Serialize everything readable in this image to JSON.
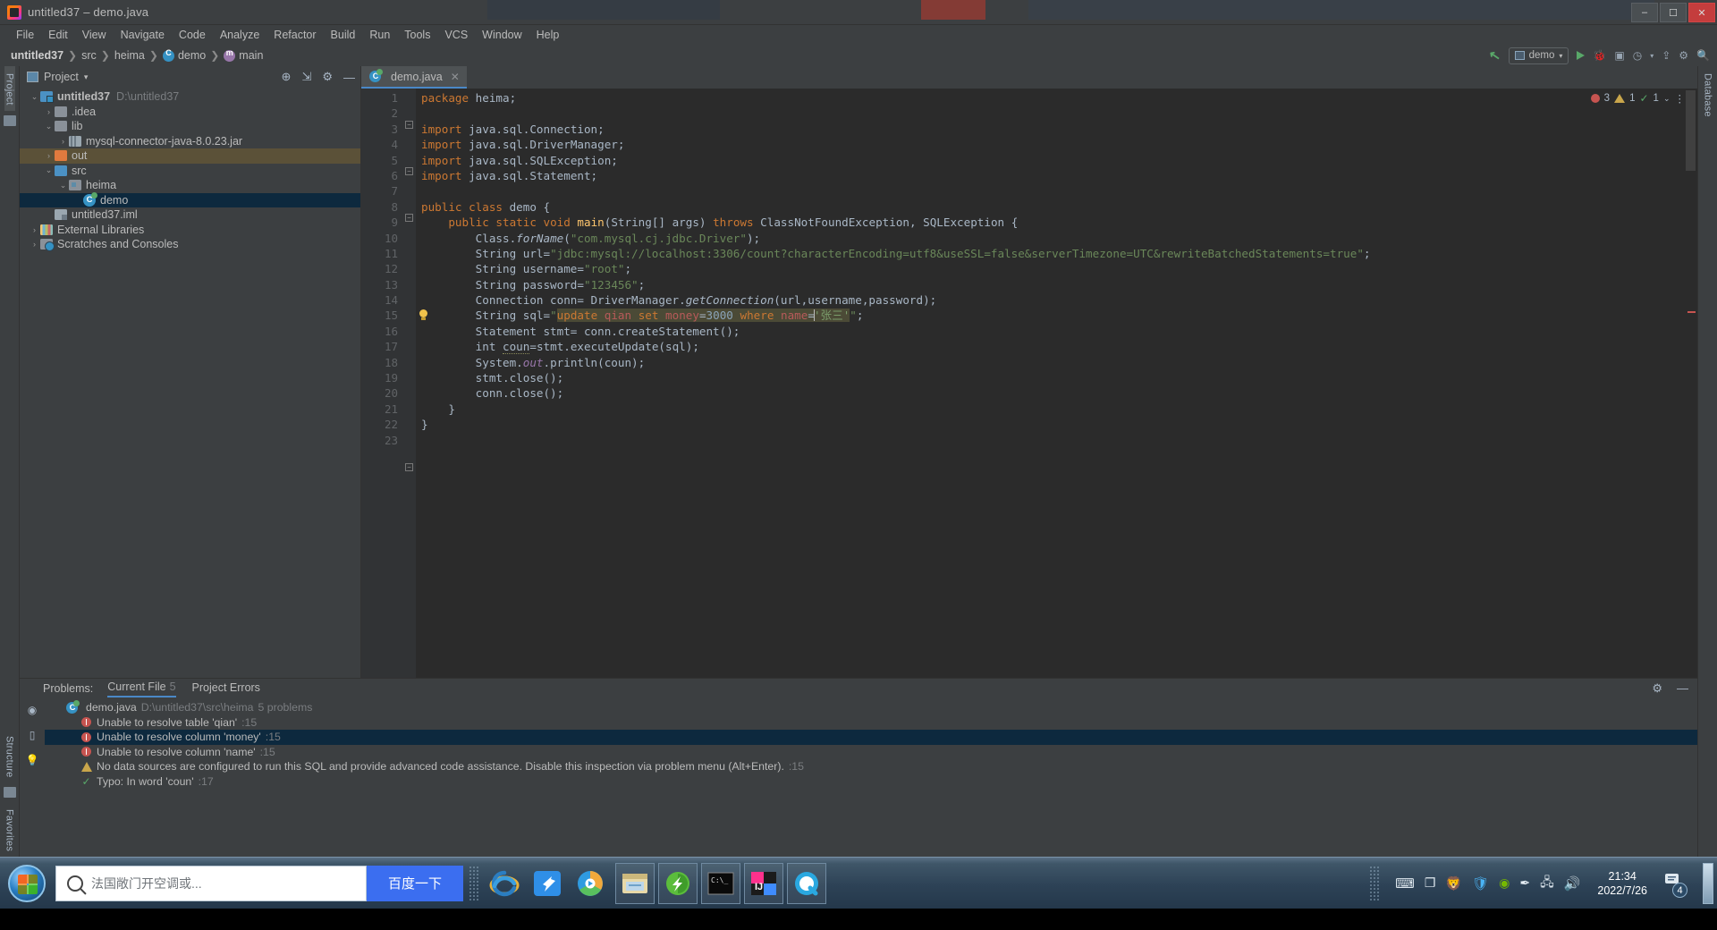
{
  "window": {
    "title": "untitled37 – demo.java",
    "minimize": "–",
    "maximize": "☐",
    "close": "✕"
  },
  "menubar": {
    "items": [
      "File",
      "Edit",
      "View",
      "Navigate",
      "Code",
      "Analyze",
      "Refactor",
      "Build",
      "Run",
      "Tools",
      "VCS",
      "Window",
      "Help"
    ]
  },
  "breadcrumb": {
    "project": "untitled37",
    "src": "src",
    "package": "heima",
    "class": "demo",
    "method": "main",
    "separator": "❯"
  },
  "toolbar_right": {
    "run_config": "demo",
    "hammer_icon": "build-icon",
    "run_icon": "▶",
    "debug_icon": "debug-icon",
    "coverage_icon": "coverage-icon",
    "profiler_icon": "profiler-icon",
    "dropdown_icon": "▾",
    "search_icon": "search-icon",
    "settings_icon": "settings-icon"
  },
  "left_rail": {
    "project_label": "Project",
    "structure_label": "Structure",
    "favorites_label": "Favorites"
  },
  "right_rail": {
    "database_label": "Database"
  },
  "project_panel": {
    "title": "Project",
    "caret": "▾",
    "tools": [
      "target-icon",
      "collapse-all-icon",
      "settings-gear-icon",
      "minimize-icon"
    ],
    "tree": [
      {
        "label": "untitled37",
        "path": "D:\\untitled37",
        "depth": 0,
        "arrow": "⌄",
        "icon": "project-folder-icon",
        "bold": true,
        "state": "normal"
      },
      {
        "label": ".idea",
        "path": "",
        "depth": 1,
        "arrow": "›",
        "icon": "folder-icon",
        "bold": false,
        "state": "normal"
      },
      {
        "label": "lib",
        "path": "",
        "depth": 1,
        "arrow": "⌄",
        "icon": "folder-icon",
        "bold": false,
        "state": "normal"
      },
      {
        "label": "mysql-connector-java-8.0.23.jar",
        "path": "",
        "depth": 2,
        "arrow": "›",
        "icon": "jar-icon",
        "bold": false,
        "state": "normal"
      },
      {
        "label": "out",
        "path": "",
        "depth": 1,
        "arrow": "›",
        "icon": "output-folder-icon",
        "bold": false,
        "state": "highlight"
      },
      {
        "label": "src",
        "path": "",
        "depth": 1,
        "arrow": "⌄",
        "icon": "source-folder-icon",
        "bold": false,
        "state": "normal"
      },
      {
        "label": "heima",
        "path": "",
        "depth": 2,
        "arrow": "⌄",
        "icon": "package-icon",
        "bold": false,
        "state": "normal"
      },
      {
        "label": "demo",
        "path": "",
        "depth": 3,
        "arrow": "",
        "icon": "java-class-icon",
        "bold": false,
        "state": "selected"
      },
      {
        "label": "untitled37.iml",
        "path": "",
        "depth": 1,
        "arrow": "",
        "icon": "iml-file-icon",
        "bold": false,
        "state": "normal"
      },
      {
        "label": "External Libraries",
        "path": "",
        "depth": 0,
        "arrow": "›",
        "icon": "libraries-icon",
        "bold": false,
        "state": "normal"
      },
      {
        "label": "Scratches and Consoles",
        "path": "",
        "depth": 0,
        "arrow": "›",
        "icon": "scratches-icon",
        "bold": false,
        "state": "normal"
      }
    ]
  },
  "editor": {
    "tab": {
      "label": "demo.java",
      "icon": "java-class-icon",
      "close": "✕"
    },
    "inspection_widget": {
      "errors": "3",
      "warnings": "1",
      "ok": "1",
      "error_icon": "error-icon",
      "warning_icon": "warning-icon",
      "ok_icon": "✓",
      "chevron": "⌄",
      "more": "⋮"
    },
    "line_count": 23,
    "lines": [
      {
        "n": 1,
        "html": "<span class='kw'>package</span> heima;"
      },
      {
        "n": 2,
        "html": ""
      },
      {
        "n": 3,
        "html": "<span class='kw'>import</span> java.sql.Connection;"
      },
      {
        "n": 4,
        "html": "<span class='kw'>import</span> java.sql.DriverManager;"
      },
      {
        "n": 5,
        "html": "<span class='kw'>import</span> java.sql.SQLException;"
      },
      {
        "n": 6,
        "html": "<span class='kw'>import</span> java.sql.Statement;"
      },
      {
        "n": 7,
        "html": ""
      },
      {
        "n": 8,
        "html": "<span class='kw'>public class</span> demo {"
      },
      {
        "n": 9,
        "html": "    <span class='kw'>public static void</span> <span class='mth'>main</span>(String[] args) <span class='kw'>throws</span> ClassNotFoundException, SQLException {"
      },
      {
        "n": 10,
        "html": "        Class.<span class='ital'>forName</span>(<span class='str'>\"com.mysql.cj.jdbc.Driver\"</span>);"
      },
      {
        "n": 11,
        "html": "        String url=<span class='str'>\"jdbc:mysql://localhost:3306/count?characterEncoding=utf8&amp;useSSL=false&amp;serverTimezone=UTC&amp;rewriteBatchedStatements=true\"</span>;"
      },
      {
        "n": 12,
        "html": "        String username=<span class='str'>\"root\"</span>;"
      },
      {
        "n": 13,
        "html": "        String password=<span class='str'>\"123456\"</span>;"
      },
      {
        "n": 14,
        "html": "        Connection conn= DriverManager.<span class='ital'>getConnection</span>(url,username,password);"
      },
      {
        "n": 15,
        "html": "        String sql=<span class='str'>\"</span><span class='sqlbg'><span class='sql-kw'>update</span> <span class='sql-tbl'>qian</span> <span class='sql-kw'>set</span> <span class='sql-col'>money</span>=<span class='sql-num'>3000</span> <span class='sql-kw'>where</span> <span class='sql-col'>name</span>=<span class='caret'></span><span class='cn-str'>'张三'</span></span><span class='str'>\"</span>;"
      },
      {
        "n": 16,
        "html": "        Statement stmt= conn.createStatement();"
      },
      {
        "n": 17,
        "html": "        <span class='kw2'>int</span> <span style='border-bottom:1px dotted #8a8a5a'>coun</span>=stmt.executeUpdate(sql);"
      },
      {
        "n": 18,
        "html": "        System.<span class='ital' style='color:#9876aa'>out</span>.println(coun);"
      },
      {
        "n": 19,
        "html": "        stmt.close();"
      },
      {
        "n": 20,
        "html": "        conn.close();"
      },
      {
        "n": 21,
        "html": "    }"
      },
      {
        "n": 22,
        "html": "}"
      },
      {
        "n": 23,
        "html": ""
      }
    ]
  },
  "problems_panel": {
    "label": "Problems:",
    "tabs": [
      {
        "label": "Current File",
        "count": "5",
        "selected": true
      },
      {
        "label": "Project Errors",
        "count": "",
        "selected": false
      }
    ],
    "tools": [
      "settings-gear-icon",
      "minimize-icon"
    ],
    "rail_icons": [
      "eye-icon",
      "layout-icon",
      "bulb-icon"
    ],
    "file_row": {
      "name": "demo.java",
      "path": "D:\\untitled37\\src\\heima",
      "summary": "5 problems",
      "icon": "java-class-icon"
    },
    "rows": [
      {
        "severity": "error",
        "text": "Unable to resolve table 'qian'",
        "loc": ":15",
        "selected": false
      },
      {
        "severity": "error",
        "text": "Unable to resolve column 'money'",
        "loc": ":15",
        "selected": true
      },
      {
        "severity": "error",
        "text": "Unable to resolve column 'name'",
        "loc": ":15",
        "selected": false
      },
      {
        "severity": "warning",
        "text": "No data sources are configured to run this SQL and provide advanced code assistance. Disable this inspection via problem menu (Alt+Enter).",
        "loc": ":15",
        "selected": false
      },
      {
        "severity": "ok",
        "text": "Typo: In word 'coun'",
        "loc": ":17",
        "selected": false
      }
    ]
  },
  "taskbar": {
    "start_label": "start-orb-icon",
    "search_placeholder": "法国敞门开空调或...",
    "search_button": "百度一下",
    "pinned_apps": [
      "internet-explorer-icon",
      "bird-app-icon",
      "media-player-icon"
    ],
    "running_apps": [
      "file-explorer-icon",
      "thunder-download-icon",
      "cmd-console-icon",
      "intellij-idea-icon",
      "qq-browser-icon"
    ],
    "tray_icons": [
      "keyboard-icon",
      "copy-icon",
      "antivirus-icon",
      "shield-icon",
      "nvidia-icon",
      "pen-tool-icon",
      "network-icon",
      "volume-icon"
    ],
    "clock_time": "21:34",
    "clock_date": "2022/7/26",
    "notification_count": "4",
    "show_desktop": "show-desktop-button"
  }
}
